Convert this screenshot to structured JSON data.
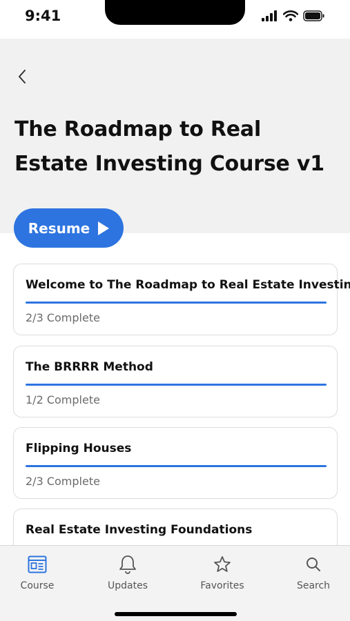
{
  "status_bar": {
    "time": "9:41"
  },
  "header": {
    "title": "The Roadmap to Real Estate Investing Course v1",
    "resume_label": "Resume"
  },
  "modules": [
    {
      "title": "Welcome to The Roadmap to Real Estate Investing",
      "progress_text": "2/3 Complete",
      "progress": 1.0
    },
    {
      "title": "The BRRRR Method",
      "progress_text": "1/2 Complete",
      "progress": 1.0
    },
    {
      "title": "Flipping Houses",
      "progress_text": "2/3 Complete",
      "progress": 1.0
    },
    {
      "title": "Real Estate Investing Foundations",
      "progress_text": "",
      "progress": 0
    }
  ],
  "tab_bar": {
    "tabs": [
      {
        "label": "Course",
        "icon": "course-icon",
        "active": true
      },
      {
        "label": "Updates",
        "icon": "bell-icon",
        "active": false
      },
      {
        "label": "Favorites",
        "icon": "star-icon",
        "active": false
      },
      {
        "label": "Search",
        "icon": "search-icon",
        "active": false
      }
    ]
  },
  "colors": {
    "accent": "#2d74e0",
    "header_bg": "#f1f1f1",
    "tab_bg": "#f3f3f3"
  }
}
